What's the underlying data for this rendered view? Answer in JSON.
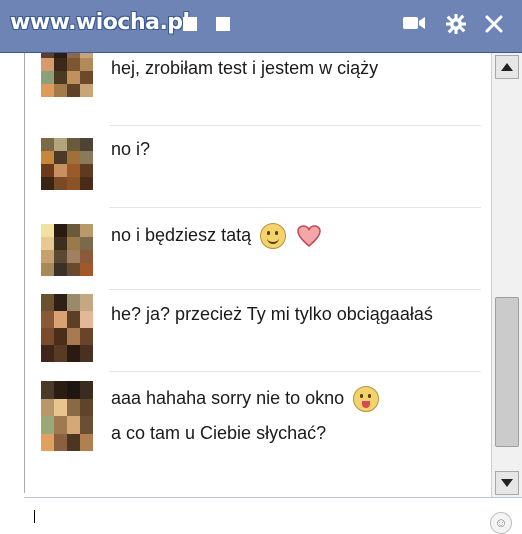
{
  "titlebar": {
    "watermark": "www.wiocha.pl",
    "icons": [
      "video-icon",
      "gear-icon",
      "close-icon"
    ],
    "background": "#6d84b4"
  },
  "messages": [
    {
      "text": "hej, zrobiłam test i jestem w ciąży",
      "emojis": []
    },
    {
      "text": "no i?",
      "emojis": []
    },
    {
      "text": "no i będziesz tatą",
      "emojis": [
        "smile-emoji",
        "heart-emoji"
      ]
    },
    {
      "text": "he? ja? przecież Ty mi tylko obciągaałaś",
      "emojis": []
    },
    {
      "text": "aaa hahaha sorry nie to okno",
      "emojis": [
        "tongue-emoji"
      ],
      "text2": "a co tam u Ciebie słychać?"
    }
  ],
  "input": {
    "value": "",
    "emoji_icon": "smile-icon"
  },
  "scrollbar": {
    "position": 0.7
  },
  "colors": {
    "text": "#1a1a1a",
    "separator": "#e1e5ee"
  }
}
